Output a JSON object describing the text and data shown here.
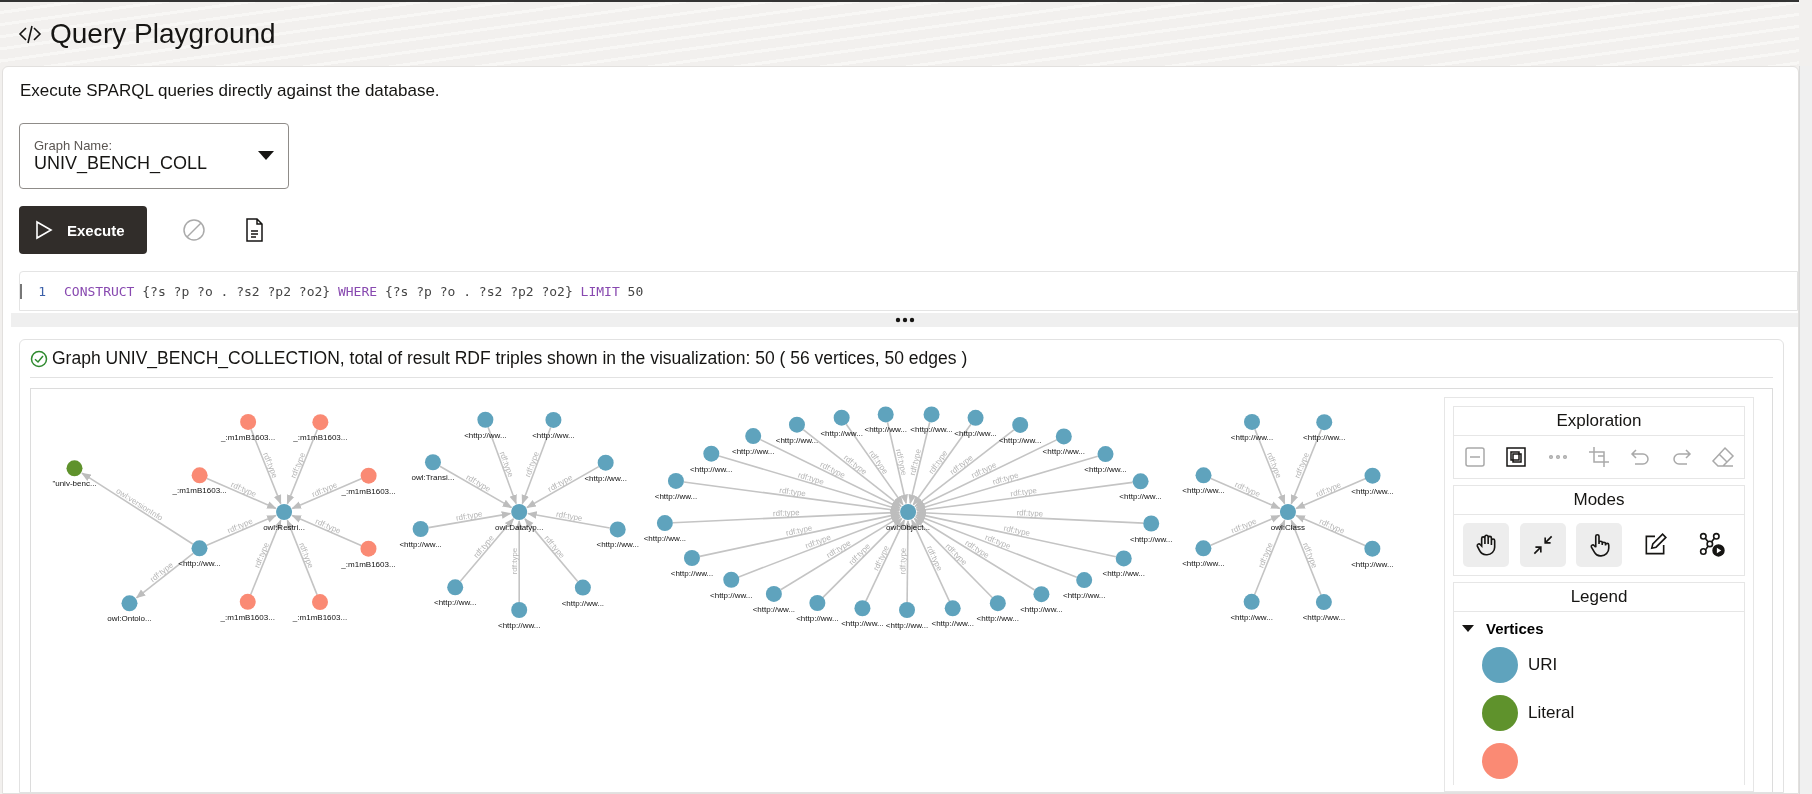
{
  "header": {
    "title": "Query Playground"
  },
  "description": "Execute SPARQL queries directly against the database.",
  "graph_select": {
    "label": "Graph Name:",
    "value": "UNIV_BENCH_COLL"
  },
  "toolbar": {
    "execute": "Execute",
    "icons": [
      {
        "kind": "cancel",
        "disabled": true
      },
      {
        "kind": "document",
        "disabled": false
      }
    ]
  },
  "editor": {
    "lines": [
      {
        "number": "1",
        "tokens": [
          {
            "text": "CONSTRUCT",
            "kind": "keyword"
          },
          {
            "text": " {?s ?p ?o . ?s2 ?p2 ?o2} ",
            "kind": "text"
          },
          {
            "text": "WHERE",
            "kind": "keyword"
          },
          {
            "text": " {?s ?p ?o . ?s2 ?p2 ?o2} ",
            "kind": "text"
          },
          {
            "text": "LIMIT",
            "kind": "keyword"
          },
          {
            "text": " 50",
            "kind": "text"
          }
        ]
      }
    ]
  },
  "result": {
    "succeeded": true,
    "message": "Graph UNIV_BENCH_COLLECTION, total of result RDF triples shown in the visualization: 50 ( 56 vertices, 50 edges )"
  },
  "graph": {
    "clusters": [
      {
        "center": {
          "label": "owl:Restri...",
          "kind": "uri"
        },
        "leaves": [
          {
            "label": "_:m1mB1603...",
            "kind": "blank",
            "edge": "rdf:type"
          },
          {
            "label": "_:m1mB1603...",
            "kind": "blank",
            "edge": "rdf:type"
          },
          {
            "label": "_:m1mB1603...",
            "kind": "blank",
            "edge": "rdf:type"
          },
          {
            "label": "_:m1mB1603...",
            "kind": "blank",
            "edge": "rdf:type"
          },
          {
            "label": "<http://ww...",
            "kind": "uri",
            "edge": "rdf:type",
            "children": [
              {
                "label": "\"univ-benc...",
                "kind": "literal",
                "edge": "owl:versionInfo"
              },
              {
                "label": "owl:Ontolo...",
                "kind": "uri",
                "edge": "rdf:type"
              }
            ]
          },
          {
            "label": "_:m1mB1603...",
            "kind": "blank",
            "edge": "rdf:type"
          },
          {
            "label": "_:m1mB1603...",
            "kind": "blank",
            "edge": "rdf:type"
          },
          {
            "label": "_:m1mB1603...",
            "kind": "blank",
            "edge": "rdf:type"
          }
        ]
      },
      {
        "center": {
          "label": "owl:Datatyp...",
          "kind": "uri"
        },
        "leaves": [
          {
            "label": "<http://ww...",
            "kind": "uri",
            "edge": "rdf:type"
          },
          {
            "label": "<http://ww...",
            "kind": "uri",
            "edge": "rdf:type"
          },
          {
            "label": "owl:Transi...",
            "kind": "uri",
            "edge": "rdf:type"
          },
          {
            "label": "<http://ww...",
            "kind": "uri",
            "edge": "rdf:type"
          },
          {
            "label": "<http://ww...",
            "kind": "uri",
            "edge": "rdf:type"
          },
          {
            "label": "<http://ww...",
            "kind": "uri",
            "edge": "rdf:type"
          },
          {
            "label": "<http://ww...",
            "kind": "uri",
            "edge": "rdf:type"
          },
          {
            "label": "<http://ww...",
            "kind": "uri",
            "edge": "rdf:type"
          },
          {
            "label": "<http://ww...",
            "kind": "uri",
            "edge": "rdf:type"
          }
        ]
      },
      {
        "center": {
          "label": "owl:Object...",
          "kind": "uri"
        },
        "leaves": [
          {
            "label": "<http://ww...",
            "kind": "uri",
            "edge": "rdf:type"
          },
          {
            "label": "<http://ww...",
            "kind": "uri",
            "edge": "rdf:type"
          },
          {
            "label": "<http://ww...",
            "kind": "uri",
            "edge": "rdf:type"
          },
          {
            "label": "<http://ww...",
            "kind": "uri",
            "edge": "rdf:type"
          },
          {
            "label": "<http://ww...",
            "kind": "uri",
            "edge": "rdf:type"
          },
          {
            "label": "<http://ww...",
            "kind": "uri",
            "edge": "rdf:type"
          },
          {
            "label": "<http://ww...",
            "kind": "uri",
            "edge": "rdf:type"
          },
          {
            "label": "<http://ww...",
            "kind": "uri",
            "edge": "rdf:type"
          },
          {
            "label": "<http://ww...",
            "kind": "uri",
            "edge": "rdf:type"
          },
          {
            "label": "<http://ww...",
            "kind": "uri",
            "edge": "rdf:type"
          },
          {
            "label": "<http://ww...",
            "kind": "uri",
            "edge": "rdf:type"
          },
          {
            "label": "<http://ww...",
            "kind": "uri",
            "edge": "rdf:type"
          },
          {
            "label": "<http://ww...",
            "kind": "uri",
            "edge": "rdf:type"
          },
          {
            "label": "<http://ww...",
            "kind": "uri",
            "edge": "rdf:type"
          },
          {
            "label": "<http://ww...",
            "kind": "uri",
            "edge": "rdf:type"
          },
          {
            "label": "<http://ww...",
            "kind": "uri",
            "edge": "rdf:type"
          },
          {
            "label": "<http://ww...",
            "kind": "uri",
            "edge": "rdf:type"
          },
          {
            "label": "<http://ww...",
            "kind": "uri",
            "edge": "rdf:type"
          },
          {
            "label": "<http://ww...",
            "kind": "uri",
            "edge": "rdf:type"
          },
          {
            "label": "<http://ww...",
            "kind": "uri",
            "edge": "rdf:type"
          },
          {
            "label": "<http://ww...",
            "kind": "uri",
            "edge": "rdf:type"
          },
          {
            "label": "<http://ww...",
            "kind": "uri",
            "edge": "rdf:type"
          },
          {
            "label": "<http://ww...",
            "kind": "uri",
            "edge": "rdf:type"
          },
          {
            "label": "<http://ww...",
            "kind": "uri",
            "edge": "rdf:type"
          },
          {
            "label": "<http://ww...",
            "kind": "uri",
            "edge": "rdf:type"
          }
        ]
      },
      {
        "center": {
          "label": "owl:Class",
          "kind": "uri"
        },
        "leaves": [
          {
            "label": "<http://ww...",
            "kind": "uri",
            "edge": "rdf:type"
          },
          {
            "label": "<http://ww...",
            "kind": "uri",
            "edge": "rdf:type"
          },
          {
            "label": "<http://ww...",
            "kind": "uri",
            "edge": "rdf:type"
          },
          {
            "label": "<http://ww...",
            "kind": "uri",
            "edge": "rdf:type"
          },
          {
            "label": "<http://ww...",
            "kind": "uri",
            "edge": "rdf:type"
          },
          {
            "label": "<http://ww...",
            "kind": "uri",
            "edge": "rdf:type"
          },
          {
            "label": "<http://ww...",
            "kind": "uri",
            "edge": "rdf:type"
          },
          {
            "label": "<http://ww...",
            "kind": "uri",
            "edge": "rdf:type"
          }
        ]
      }
    ]
  },
  "panel": {
    "exploration": {
      "title": "Exploration",
      "tools": [
        {
          "kind": "collapse",
          "disabled": true
        },
        {
          "kind": "fit",
          "disabled": false
        },
        {
          "kind": "more",
          "disabled": true
        },
        {
          "kind": "crop",
          "disabled": true
        },
        {
          "kind": "undo",
          "disabled": true
        },
        {
          "kind": "redo",
          "disabled": true
        },
        {
          "kind": "erase",
          "disabled": true
        }
      ]
    },
    "modes": {
      "title": "Modes",
      "tools": [
        {
          "kind": "pan",
          "active": true
        },
        {
          "kind": "shrink",
          "active": true
        },
        {
          "kind": "select",
          "active": true
        },
        {
          "kind": "edit",
          "active": false
        },
        {
          "kind": "play",
          "active": false
        }
      ]
    },
    "legend": {
      "title": "Legend",
      "sections": [
        {
          "label": "Vertices",
          "expanded": true,
          "items": [
            {
              "kind": "uri",
              "label": "URI",
              "color": "#5fa3bd"
            },
            {
              "kind": "literal",
              "label": "Literal",
              "color": "#5f922c"
            },
            {
              "kind": "blank",
              "color": "#fa8a74"
            }
          ]
        }
      ]
    }
  }
}
